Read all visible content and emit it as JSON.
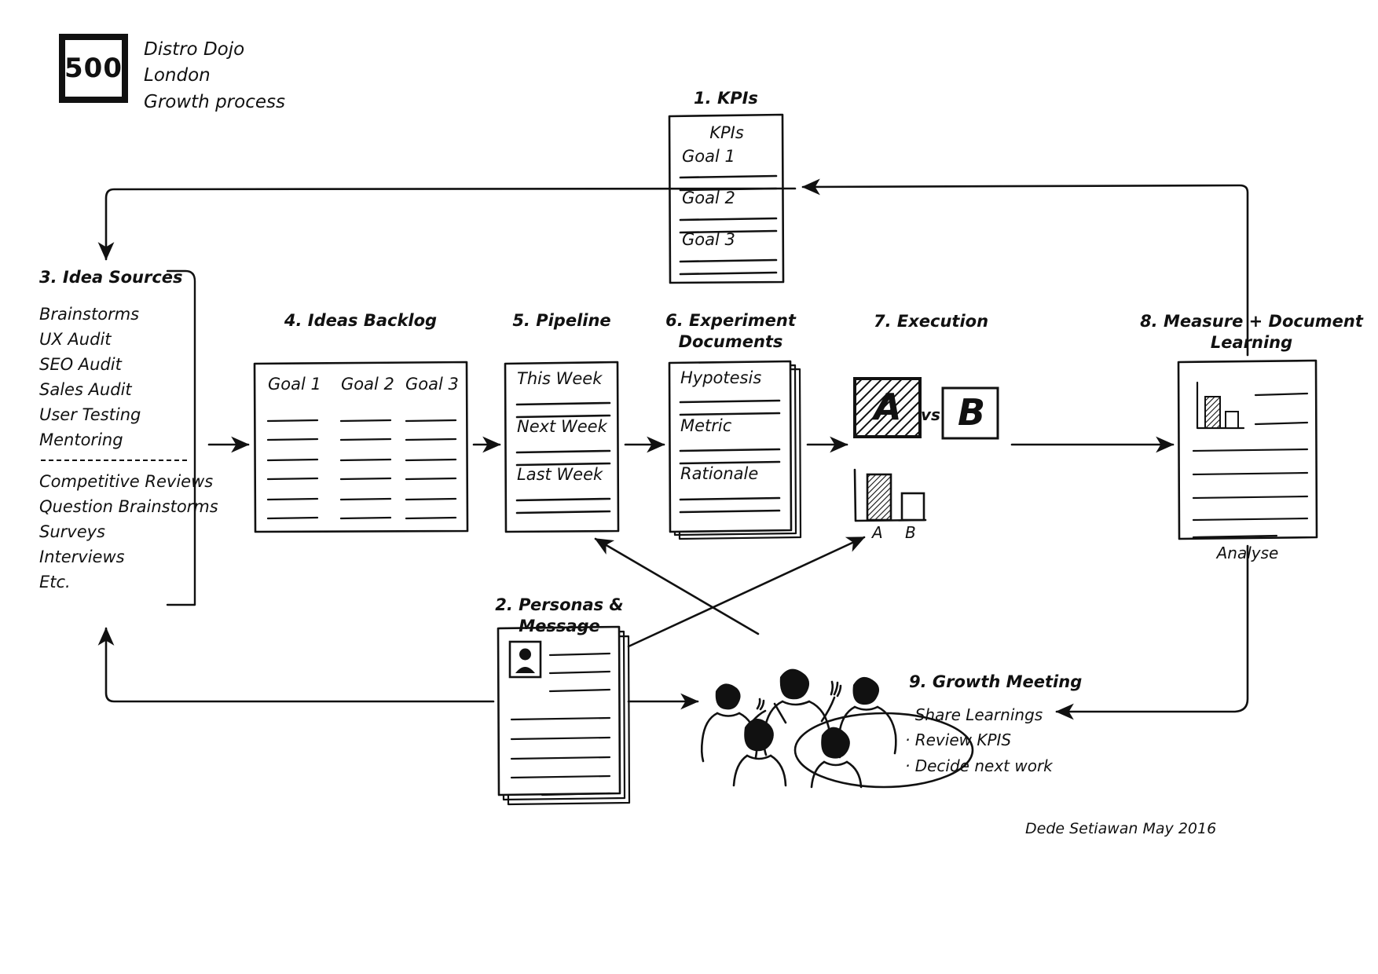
{
  "meta": {
    "title": "500 Distro Dojo London Growth process",
    "ink": "#111111",
    "paper": "#ffffff"
  },
  "logo": {
    "number": "500",
    "line1": "Distro Dojo",
    "line2": "London",
    "line3": "Growth process"
  },
  "steps": {
    "kpis": {
      "title": "1. KPIs",
      "card_header": "KPIs",
      "rows": [
        "Goal 1",
        "Goal 2",
        "Goal 3"
      ]
    },
    "personas": {
      "title": "2. Personas & Message",
      "avatar": "person-avatar-icon"
    },
    "idea_sources": {
      "title": "3. Idea Sources",
      "group_a": [
        "Brainstorms",
        "UX Audit",
        "SEO Audit",
        "Sales Audit",
        "User Testing",
        "Mentoring"
      ],
      "group_b": [
        "Competitive Reviews",
        "Question Brainstorms",
        "Surveys",
        "Interviews",
        "Etc."
      ]
    },
    "ideas_backlog": {
      "title": "4. Ideas Backlog",
      "columns": [
        "Goal 1",
        "Goal 2",
        "Goal 3"
      ],
      "rows_per_column": 6
    },
    "pipeline": {
      "title": "5. Pipeline",
      "rows": [
        "This Week",
        "Next Week",
        "Last Week"
      ]
    },
    "experiment_documents": {
      "title": "6. Experiment\nDocuments",
      "title_line1": "6. Experiment",
      "title_line2": "Documents",
      "rows": [
        "Hypotesis",
        "Metric",
        "Rationale"
      ]
    },
    "execution": {
      "title": "7. Execution",
      "variant_a": "A",
      "versus": "vs",
      "variant_b": "B",
      "chart_xlabels": [
        "A",
        "B"
      ]
    },
    "measure": {
      "title_line1": "8. Measure + Document",
      "title_line2": "Learning",
      "caption": "Analyse"
    },
    "growth_meeting": {
      "title": "9. Growth Meeting",
      "bullets": [
        "Share Learnings",
        "Review KPIS",
        "Decide next work"
      ]
    }
  },
  "chart_data": [
    {
      "type": "bar",
      "name": "execution-ab-result",
      "categories": [
        "A",
        "B"
      ],
      "values": [
        0.8,
        0.45
      ],
      "title": "",
      "xlabel": "",
      "ylabel": "",
      "ylim": [
        0,
        1
      ],
      "grid": false,
      "legend": "none",
      "series_styles": [
        "hatched",
        "outline"
      ]
    },
    {
      "type": "bar",
      "name": "measure-document-thumbnail",
      "categories": [
        "A",
        "B"
      ],
      "values": [
        0.85,
        0.42
      ],
      "title": "",
      "xlabel": "",
      "ylabel": "",
      "ylim": [
        0,
        1
      ],
      "grid": false,
      "legend": "none",
      "series_styles": [
        "hatched",
        "outline"
      ]
    }
  ],
  "credit": "Dede Setiawan   May 2016"
}
